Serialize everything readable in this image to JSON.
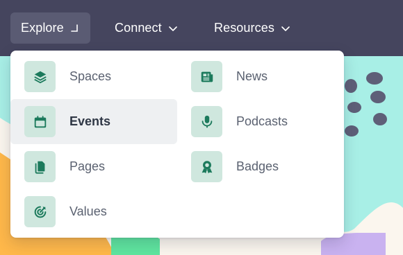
{
  "nav": {
    "items": [
      {
        "label": "Explore",
        "state": "open",
        "icon": "chevron-up-icon"
      },
      {
        "label": "Connect",
        "state": "closed",
        "icon": "chevron-down-icon"
      },
      {
        "label": "Resources",
        "state": "closed",
        "icon": "chevron-down-icon"
      }
    ]
  },
  "dropdown": {
    "items": [
      {
        "label": "Spaces",
        "icon": "layers-icon"
      },
      {
        "label": "News",
        "icon": "newspaper-icon"
      },
      {
        "label": "Events",
        "icon": "calendar-icon",
        "hovered": true
      },
      {
        "label": "Podcasts",
        "icon": "microphone-icon"
      },
      {
        "label": "Pages",
        "icon": "pages-icon"
      },
      {
        "label": "Badges",
        "icon": "badge-icon"
      },
      {
        "label": "Values",
        "icon": "target-icon"
      }
    ]
  },
  "colors": {
    "navbar": "#45455e",
    "nav_active": "#5a5b73",
    "icon_bg": "#cfe7de",
    "icon_fg": "#1c7a5c",
    "hover_bg": "#eef0f2"
  }
}
